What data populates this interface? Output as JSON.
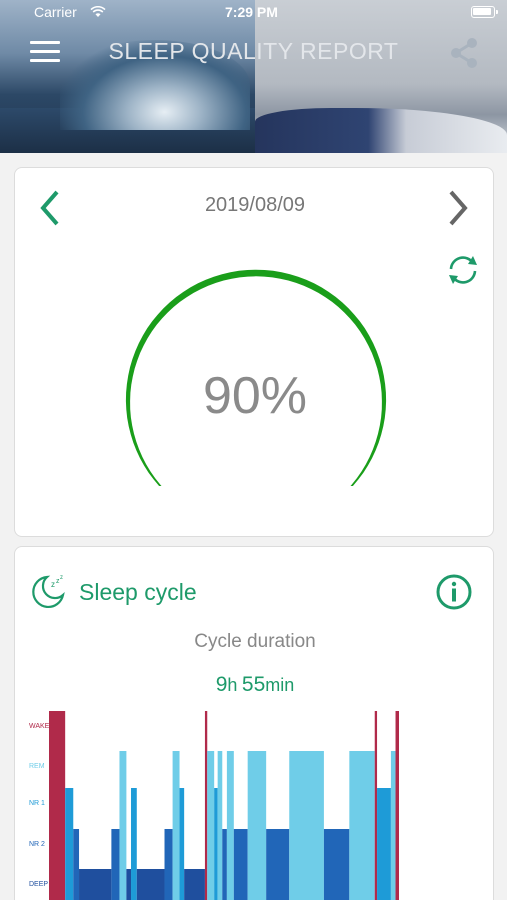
{
  "status_bar": {
    "carrier": "Carrier",
    "time": "7:29 PM"
  },
  "header": {
    "title": "SLEEP QUALITY REPORT",
    "menu_icon": "hamburger-menu-icon",
    "share_icon": "share-icon"
  },
  "report": {
    "date": "2019/08/09",
    "score_label": "90%",
    "score_value": 0.9,
    "gauge_color": "#1a9e1a"
  },
  "sleep_cycle": {
    "title": "Sleep cycle",
    "cycle_label": "Cycle duration",
    "hours": "9",
    "hours_unit": "h",
    "minutes": "55",
    "minutes_unit": "min",
    "accent_color": "#1e9a6a"
  },
  "chart_data": {
    "type": "bar",
    "stage_labels": [
      "WAKE",
      "REM",
      "NR 1",
      "NR 2",
      "DEEP"
    ],
    "stage_colors": {
      "WAKE": "#b02a4a",
      "REM": "#6fcde8",
      "NR 1": "#1e9bd7",
      "NR 2": "#2166b8",
      "DEEP": "#1f4f9e"
    },
    "segments": [
      {
        "stage": "WAKE",
        "duration": 14
      },
      {
        "stage": "NR 1",
        "duration": 7
      },
      {
        "stage": "NR 2",
        "duration": 5
      },
      {
        "stage": "DEEP",
        "duration": 28
      },
      {
        "stage": "NR 2",
        "duration": 7
      },
      {
        "stage": "REM",
        "duration": 6
      },
      {
        "stage": "DEEP",
        "duration": 4
      },
      {
        "stage": "NR 1",
        "duration": 5
      },
      {
        "stage": "DEEP",
        "duration": 24
      },
      {
        "stage": "NR 2",
        "duration": 7
      },
      {
        "stage": "REM",
        "duration": 6
      },
      {
        "stage": "NR 1",
        "duration": 4
      },
      {
        "stage": "DEEP",
        "duration": 18
      },
      {
        "stage": "WAKE",
        "duration": 2
      },
      {
        "stage": "REM",
        "duration": 6
      },
      {
        "stage": "NR 1",
        "duration": 3
      },
      {
        "stage": "REM",
        "duration": 4
      },
      {
        "stage": "NR 2",
        "duration": 4
      },
      {
        "stage": "REM",
        "duration": 6
      },
      {
        "stage": "NR 2",
        "duration": 12
      },
      {
        "stage": "REM",
        "duration": 16
      },
      {
        "stage": "NR 2",
        "duration": 20
      },
      {
        "stage": "REM",
        "duration": 30
      },
      {
        "stage": "NR 2",
        "duration": 22
      },
      {
        "stage": "REM",
        "duration": 22
      },
      {
        "stage": "WAKE",
        "duration": 2
      },
      {
        "stage": "NR 1",
        "duration": 12
      },
      {
        "stage": "REM",
        "duration": 4
      },
      {
        "stage": "WAKE",
        "duration": 3
      }
    ]
  }
}
